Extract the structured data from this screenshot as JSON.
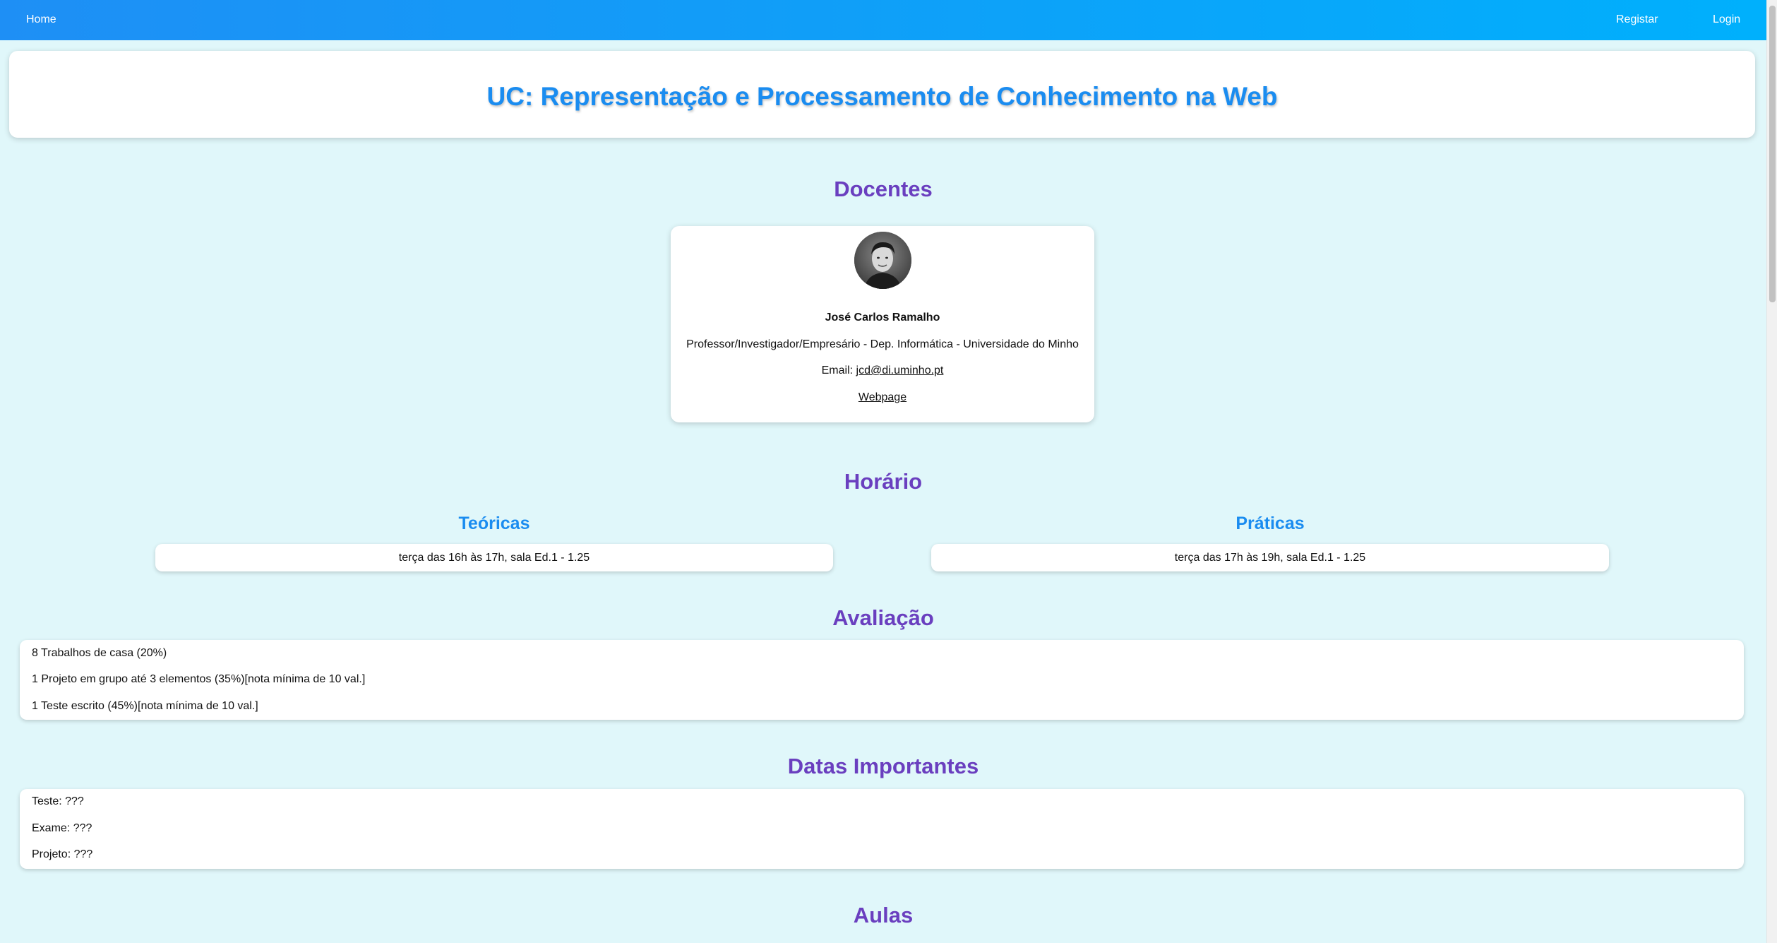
{
  "nav": {
    "home": "Home",
    "register": "Registar",
    "login": "Login"
  },
  "header": {
    "title": "UC: Representação e Processamento de Conhecimento na Web"
  },
  "docentes": {
    "title": "Docentes",
    "teacher": {
      "name": "José Carlos Ramalho",
      "role": "Professor/Investigador/Empresário - Dep. Informática - Universidade do Minho",
      "email_label": "Email: ",
      "email": "jcd@di.uminho.pt",
      "webpage": "Webpage"
    }
  },
  "horario": {
    "title": "Horário",
    "teoricas": {
      "title": "Teóricas",
      "text": "terça das 16h às 17h, sala Ed.1 - 1.25"
    },
    "praticas": {
      "title": "Práticas",
      "text": "terça das 17h às 19h, sala Ed.1 - 1.25"
    }
  },
  "avaliacao": {
    "title": "Avaliação",
    "items": [
      "8 Trabalhos de casa (20%)",
      "1 Projeto em grupo até 3 elementos (35%)[nota mínima de 10 val.]",
      "1 Teste escrito (45%)[nota mínima de 10 val.]"
    ]
  },
  "datas": {
    "title": "Datas Importantes",
    "items": [
      "Teste: ???",
      "Exame: ???",
      "Projeto: ???"
    ]
  },
  "aulas": {
    "title": "Aulas"
  },
  "colors": {
    "nav_start": "#1e8ff5",
    "nav_end": "#00b0fc",
    "background": "#e0f7fa",
    "title_blue": "#1a8cf0",
    "section_purple": "#6a3fbf"
  }
}
